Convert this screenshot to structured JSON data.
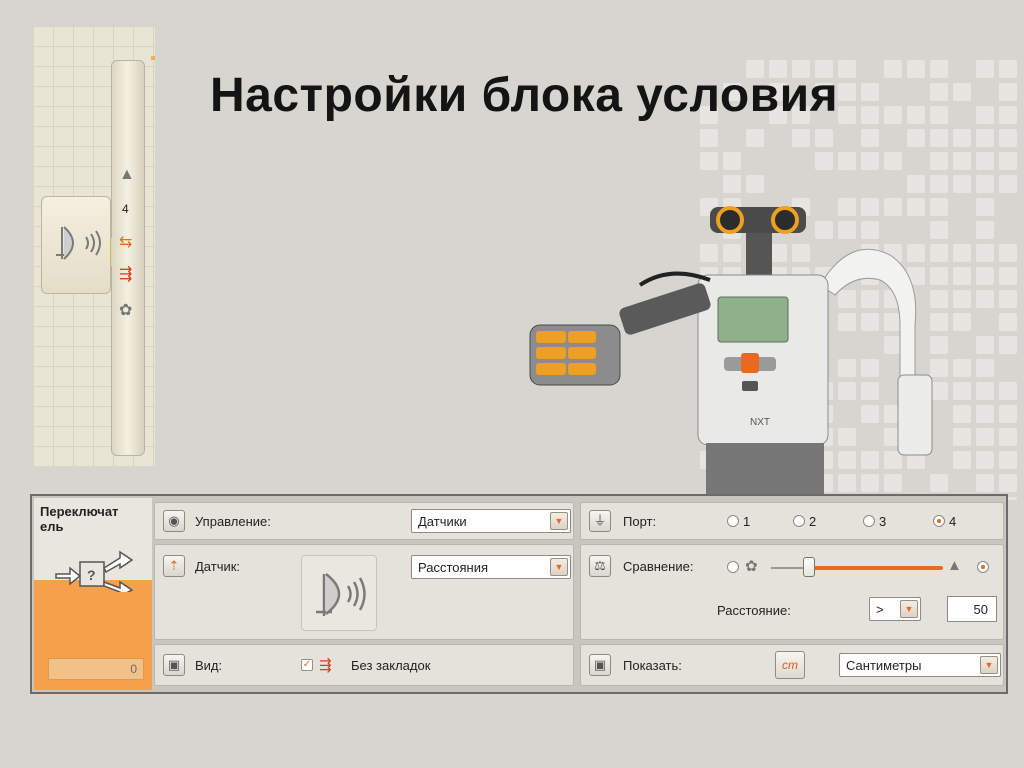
{
  "slide": {
    "title": "Настройки блока условия"
  },
  "strip": {
    "port_number": "4"
  },
  "panel": {
    "block_title": "Переключат\nель",
    "counter_value": "0",
    "control": {
      "label": "Управление:",
      "value": "Датчики"
    },
    "sensor": {
      "label": "Датчик:",
      "value": "Расстояния"
    },
    "view": {
      "label": "Вид:",
      "checkbox_checked": true,
      "checkbox_label": "Без закладок"
    },
    "port": {
      "label": "Порт:",
      "options": [
        "1",
        "2",
        "3",
        "4"
      ],
      "selected": "4"
    },
    "compare": {
      "label": "Сравнение:",
      "slider_fraction": 0.05,
      "selected_side": "far"
    },
    "distance": {
      "label": "Расстояние:",
      "operator": ">",
      "value": "50"
    },
    "show": {
      "label": "Показать:",
      "unit_button": "cm",
      "unit_value": "Сантиметры"
    }
  },
  "colors": {
    "accent_orange": "#f5a04a",
    "slider_orange": "#e8691f",
    "robot_nxt_screen": "#8fb08a"
  },
  "icons": {
    "eye": "eye-icon",
    "sensor_select": "sensor-select-icon",
    "view": "view-icon",
    "port": "port-plug-icon",
    "compare": "scales-icon",
    "show": "display-icon",
    "ultrasonic": "ultrasonic-sensor-icon",
    "switch": "switch-block-icon"
  }
}
